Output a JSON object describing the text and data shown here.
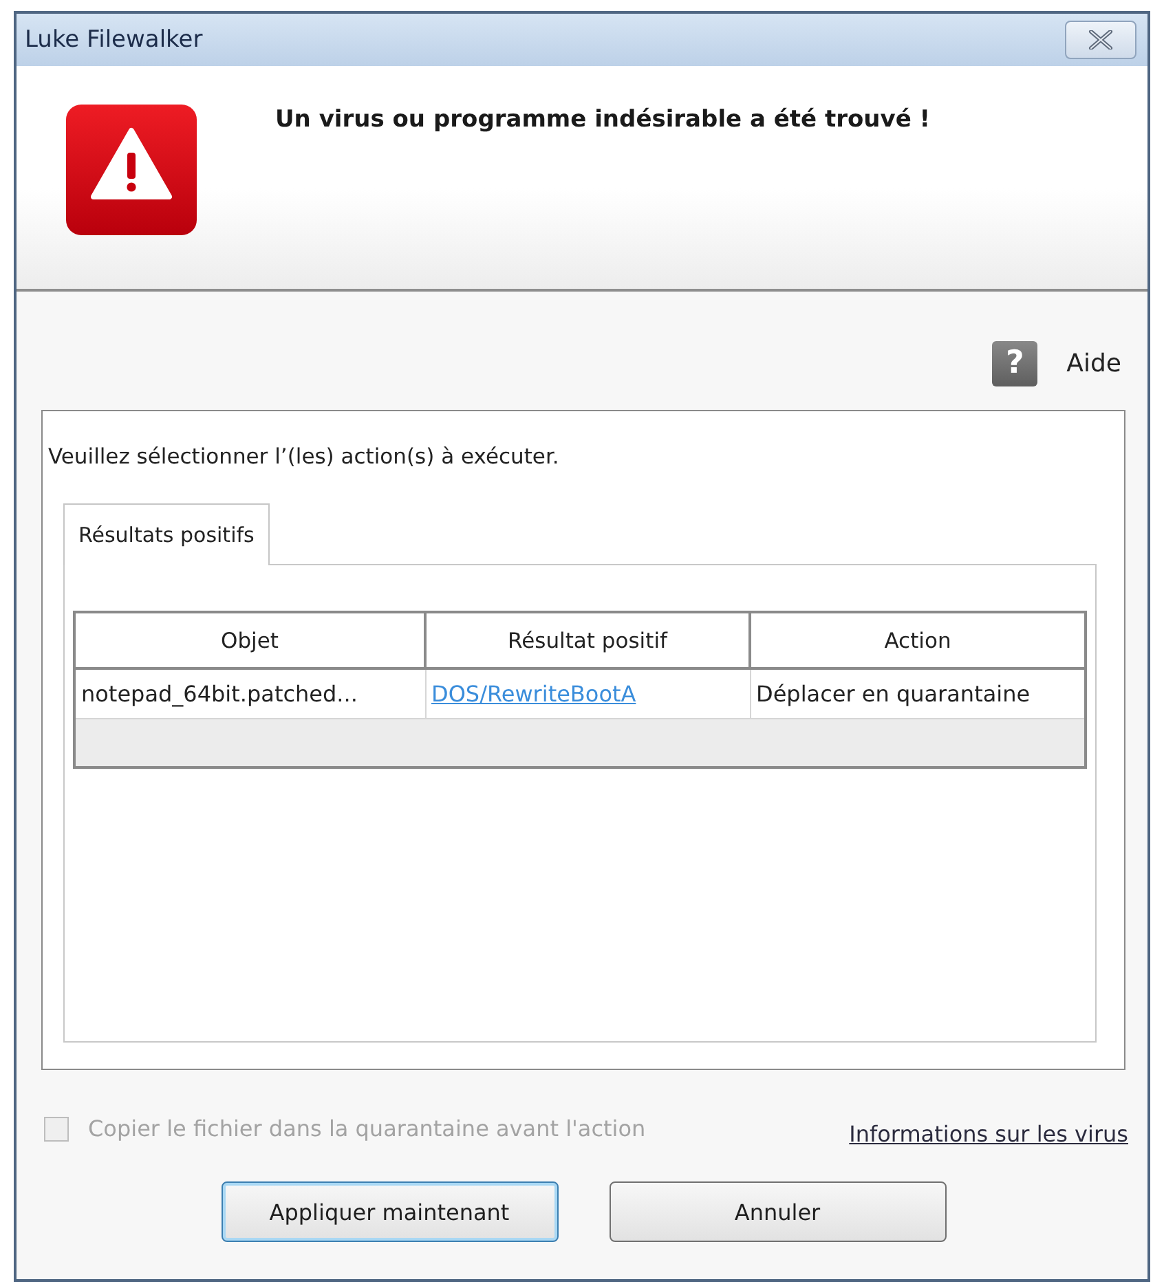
{
  "window": {
    "title": "Luke Filewalker"
  },
  "header": {
    "message": "Un virus ou programme indésirable a été trouvé !"
  },
  "help": {
    "icon": "?",
    "label": "Aide"
  },
  "group": {
    "instruction": "Veuillez sélectionner l’(les) action(s) à exécuter."
  },
  "tabs": [
    {
      "label": "Résultats positifs",
      "selected": true
    }
  ],
  "table": {
    "columns": [
      "Objet",
      "Résultat positif",
      "Action"
    ],
    "rows": [
      {
        "cells": [
          {
            "kind": "text",
            "text": "notepad_64bit.patched..."
          },
          {
            "kind": "link",
            "text": "DOS/RewriteBootA"
          },
          {
            "kind": "text",
            "text": "Déplacer en quarantaine"
          }
        ]
      }
    ]
  },
  "footer": {
    "checkbox": {
      "label": "Copier le fichier dans la quarantaine avant l'action",
      "checked": false,
      "disabled": true
    },
    "link": "Informations sur les virus"
  },
  "buttons": [
    {
      "label": "Appliquer maintenant",
      "default": true
    },
    {
      "label": "Annuler",
      "default": false
    }
  ]
}
